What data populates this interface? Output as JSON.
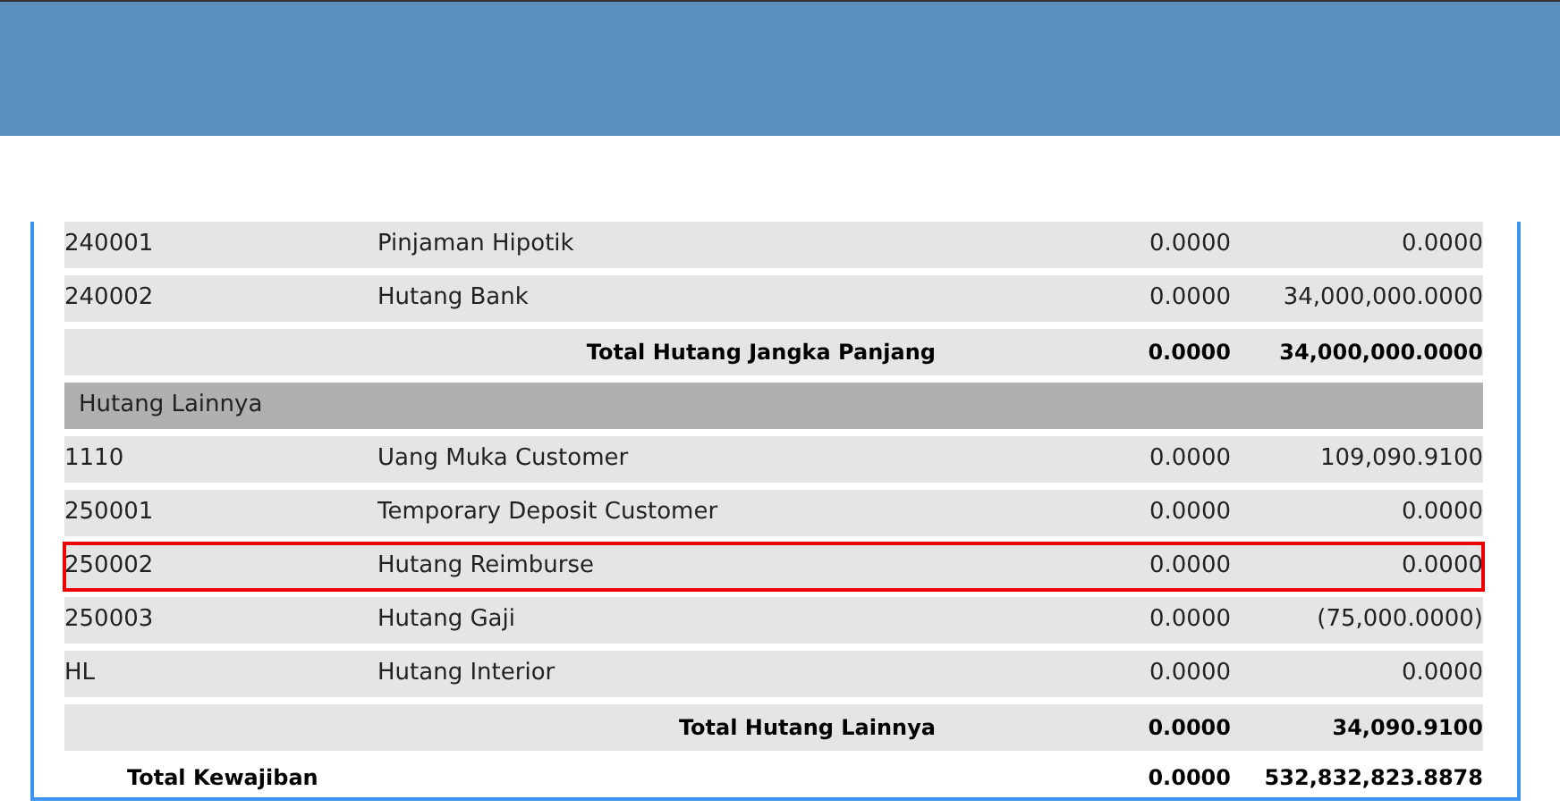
{
  "rows": [
    {
      "kind": "account",
      "code": "240001",
      "name": "Pinjaman Hipotik",
      "column_3": "0.0000",
      "column_4": "0.0000",
      "selected": false
    },
    {
      "kind": "account",
      "code": "240002",
      "name": "Hutang Bank",
      "column_3": "0.0000",
      "column_4": "34,000,000.0000",
      "selected": false
    },
    {
      "kind": "subtotal",
      "name": "Total Hutang Jangka Panjang",
      "column_3": "0.0000",
      "column_4": "34,000,000.0000"
    },
    {
      "kind": "section",
      "name": "Hutang Lainnya"
    },
    {
      "kind": "account",
      "code": "1110",
      "name": "Uang Muka Customer",
      "column_3": "0.0000",
      "column_4": "109,090.9100",
      "selected": false
    },
    {
      "kind": "account",
      "code": "250001",
      "name": "Temporary Deposit Customer",
      "column_3": "0.0000",
      "column_4": "0.0000",
      "selected": false
    },
    {
      "kind": "account",
      "code": "250002",
      "name": "Hutang Reimburse",
      "column_3": "0.0000",
      "column_4": "0.0000",
      "selected": true
    },
    {
      "kind": "account",
      "code": "250003",
      "name": "Hutang Gaji",
      "column_3": "0.0000",
      "column_4": "(75,000.0000)",
      "selected": false
    },
    {
      "kind": "account",
      "code": "HL",
      "name": "Hutang Interior",
      "column_3": "0.0000",
      "column_4": "0.0000",
      "selected": false
    },
    {
      "kind": "subtotal",
      "name": "Total Hutang Lainnya",
      "column_3": "0.0000",
      "column_4": "34,090.9100"
    },
    {
      "kind": "grand_total",
      "name": "Total Kewajiban",
      "column_3": "0.0000",
      "column_4": "532,832,823.8878"
    }
  ]
}
